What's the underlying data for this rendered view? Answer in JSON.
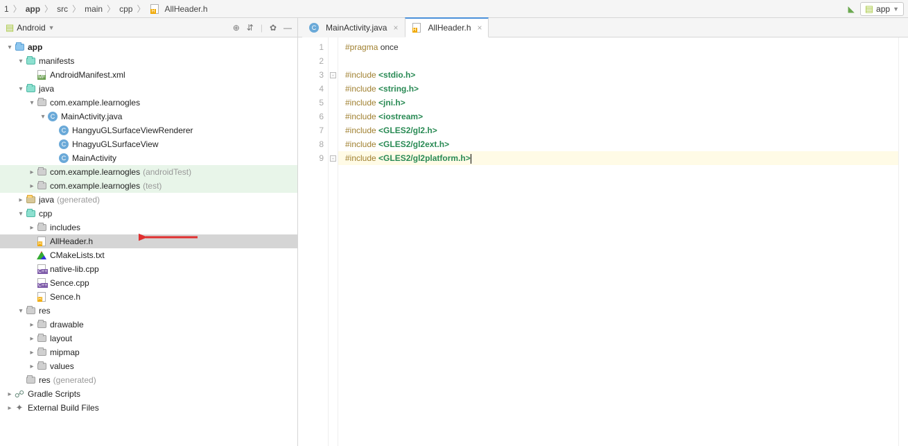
{
  "breadcrumb": [
    "1",
    "app",
    "src",
    "main",
    "cpp",
    "AllHeader.h"
  ],
  "run_config": "app",
  "project_tool": "Android",
  "tree": [
    {
      "d": 0,
      "exp": "down",
      "icon": "folder-blue",
      "text": "app",
      "bold": true
    },
    {
      "d": 1,
      "exp": "down",
      "icon": "folder-teal",
      "text": "manifests"
    },
    {
      "d": 2,
      "exp": "none",
      "icon": "file-mf",
      "text": "AndroidManifest.xml"
    },
    {
      "d": 1,
      "exp": "down",
      "icon": "folder-teal",
      "text": "java"
    },
    {
      "d": 2,
      "exp": "down",
      "icon": "folder-gray",
      "text": "com.example.learnogles"
    },
    {
      "d": 3,
      "exp": "down",
      "icon": "circ-c",
      "text": "MainActivity.java"
    },
    {
      "d": 4,
      "exp": "none",
      "icon": "circ-c",
      "text": "HangyuGLSurfaceViewRenderer"
    },
    {
      "d": 4,
      "exp": "none",
      "icon": "circ-c",
      "text": "HnagyuGLSurfaceView"
    },
    {
      "d": 4,
      "exp": "none",
      "icon": "circ-c",
      "text": "MainActivity"
    },
    {
      "d": 2,
      "exp": "right",
      "icon": "folder-gray",
      "text": "com.example.learnogles",
      "muted": "(androidTest)",
      "success": true
    },
    {
      "d": 2,
      "exp": "right",
      "icon": "folder-gray",
      "text": "com.example.learnogles",
      "muted": "(test)",
      "success": true
    },
    {
      "d": 1,
      "exp": "right",
      "icon": "folder-gen",
      "text": "java",
      "muted": "(generated)"
    },
    {
      "d": 1,
      "exp": "down",
      "icon": "folder-teal",
      "text": "cpp"
    },
    {
      "d": 2,
      "exp": "right",
      "icon": "folder-gray",
      "text": "includes"
    },
    {
      "d": 2,
      "exp": "none",
      "icon": "file-h",
      "text": "AllHeader.h",
      "selected": true
    },
    {
      "d": 2,
      "exp": "none",
      "icon": "cmake",
      "text": "CMakeLists.txt"
    },
    {
      "d": 2,
      "exp": "none",
      "icon": "file-cpp",
      "text": "native-lib.cpp"
    },
    {
      "d": 2,
      "exp": "none",
      "icon": "file-cpp",
      "text": "Sence.cpp"
    },
    {
      "d": 2,
      "exp": "none",
      "icon": "file-h",
      "text": "Sence.h"
    },
    {
      "d": 1,
      "exp": "down",
      "icon": "folder-gray",
      "text": "res"
    },
    {
      "d": 2,
      "exp": "right",
      "icon": "folder-gray",
      "text": "drawable"
    },
    {
      "d": 2,
      "exp": "right",
      "icon": "folder-gray",
      "text": "layout"
    },
    {
      "d": 2,
      "exp": "right",
      "icon": "folder-gray",
      "text": "mipmap"
    },
    {
      "d": 2,
      "exp": "right",
      "icon": "folder-gray",
      "text": "values"
    },
    {
      "d": 1,
      "exp": "none",
      "icon": "folder-gray",
      "text": "res",
      "muted": "(generated)"
    },
    {
      "d": 0,
      "exp": "right",
      "icon": "gradle",
      "text": "Gradle Scripts"
    },
    {
      "d": 0,
      "exp": "right",
      "icon": "wrench",
      "text": "External Build Files"
    }
  ],
  "tabs": [
    {
      "icon": "circ-c",
      "label": "MainActivity.java",
      "active": false
    },
    {
      "icon": "file-h",
      "label": "AllHeader.h",
      "active": true
    }
  ],
  "lines": [
    {
      "n": 1,
      "tokens": [
        [
          "pragma",
          "#pragma"
        ],
        [
          "once",
          " once"
        ]
      ]
    },
    {
      "n": 2,
      "tokens": []
    },
    {
      "n": 3,
      "mk": true,
      "tokens": [
        [
          "inc",
          "#include "
        ],
        [
          "hdr",
          "<stdio.h>"
        ]
      ]
    },
    {
      "n": 4,
      "tokens": [
        [
          "inc",
          "#include "
        ],
        [
          "hdr",
          "<string.h>"
        ]
      ]
    },
    {
      "n": 5,
      "tokens": [
        [
          "inc",
          "#include "
        ],
        [
          "hdr",
          "<jni.h>"
        ]
      ]
    },
    {
      "n": 6,
      "tokens": [
        [
          "inc",
          "#include "
        ],
        [
          "hdr",
          "<iostream>"
        ]
      ]
    },
    {
      "n": 7,
      "tokens": [
        [
          "inc",
          "#include "
        ],
        [
          "hdr",
          "<GLES2/gl2.h>"
        ]
      ]
    },
    {
      "n": 8,
      "tokens": [
        [
          "inc",
          "#include "
        ],
        [
          "hdr",
          "<GLES2/gl2ext.h>"
        ]
      ]
    },
    {
      "n": 9,
      "mk": true,
      "hl": true,
      "cursor": true,
      "tokens": [
        [
          "inc",
          "#include "
        ],
        [
          "hdr",
          "<GLES2/gl2platform.h>"
        ]
      ]
    }
  ]
}
